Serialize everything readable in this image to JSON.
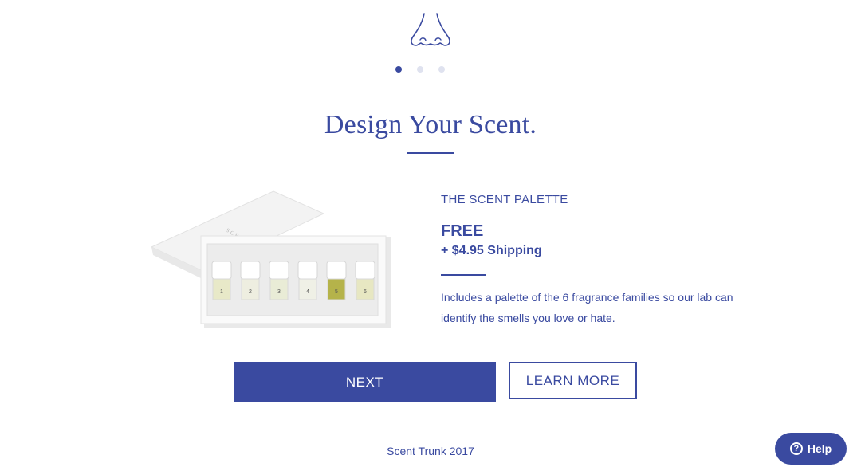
{
  "brand": {
    "logo_icon": "nose-icon",
    "accent": "#3a4aa0"
  },
  "carousel": {
    "step_count": 3,
    "active_step": 1
  },
  "heading": "Design Your Scent.",
  "product": {
    "image_label": "scent-palette-box",
    "box_text": "SCENT TRUNK",
    "vial_numbers": [
      "1",
      "2",
      "3",
      "4",
      "5",
      "6"
    ],
    "name": "THE SCENT PALETTE",
    "price": "FREE",
    "shipping": "+ $4.95 Shipping",
    "description": "Includes a palette of the 6 fragrance families so our lab can identify the smells you love or hate."
  },
  "actions": {
    "next_label": "NEXT",
    "learn_more_label": "LEARN MORE"
  },
  "footer": {
    "text": "Scent Trunk 2017"
  },
  "help": {
    "label": "Help",
    "icon": "question-icon",
    "icon_glyph": "?"
  }
}
